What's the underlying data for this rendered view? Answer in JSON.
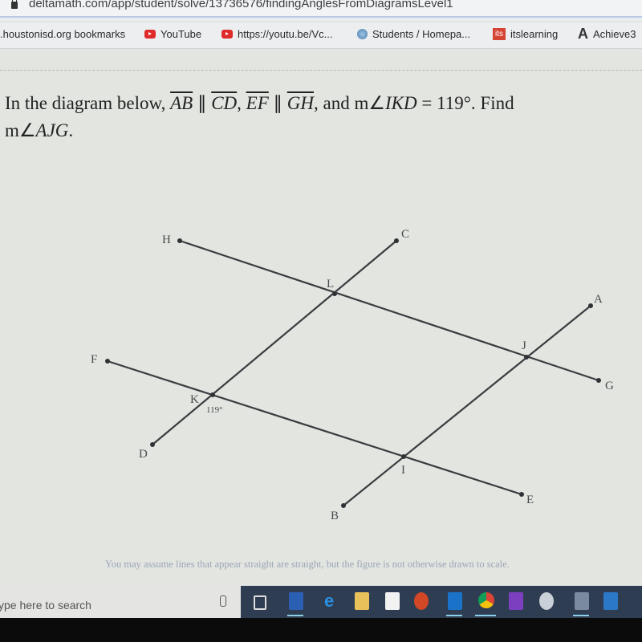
{
  "browser": {
    "url": "deltamath.com/app/student/solve/13736576/findingAnglesFromDiagramsLevel1",
    "bookmarks": [
      {
        "label": ".houstonisd.org bookmarks",
        "icon": "none"
      },
      {
        "label": "YouTube",
        "icon": "youtube-icon"
      },
      {
        "label": "https://youtu.be/Vc...",
        "icon": "youtube-icon"
      },
      {
        "label": "Students / Homepa...",
        "icon": "globe-icon"
      },
      {
        "label": "itslearning",
        "icon": "its-icon"
      },
      {
        "label": "Achieve3",
        "icon": "achieve-icon"
      }
    ]
  },
  "problem": {
    "intro": "In the diagram below, ",
    "seg1": "AB",
    "par1": " ∥ ",
    "seg2": "CD",
    "comma": ", ",
    "seg3": "EF",
    "par2": " ∥ ",
    "seg4": "GH",
    "given_prefix": ", and m∠",
    "given_angle": "IKD",
    "given_value": " = 119°. Find",
    "find_prefix": "m∠",
    "find_angle": "AJG",
    "find_suffix": "."
  },
  "diagram": {
    "points": {
      "H": "H",
      "C": "C",
      "L": "L",
      "A": "A",
      "J": "J",
      "G": "G",
      "F": "F",
      "K": "K",
      "D": "D",
      "I": "I",
      "E": "E",
      "B": "B"
    },
    "angle_label": "119°",
    "note": "You may assume lines that appear straight are straight, but the figure is not otherwise drawn to scale."
  },
  "taskbar": {
    "search_placeholder": "ype here to search",
    "apps": [
      "task-view",
      "word",
      "edge",
      "file-explorer",
      "store",
      "powerpoint",
      "outlook",
      "chrome",
      "onenote",
      "snip",
      "calculator",
      "whiteboard"
    ]
  }
}
